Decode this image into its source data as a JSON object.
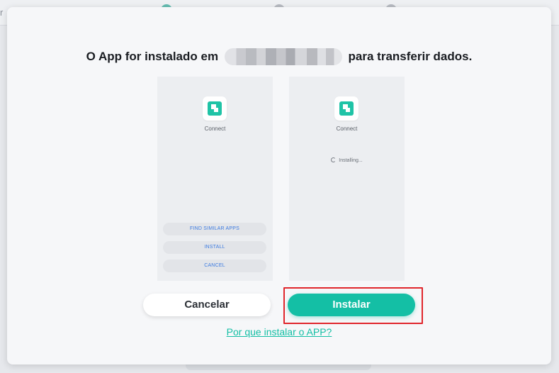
{
  "background": {
    "left_fragment": "r"
  },
  "dialog": {
    "title_prefix": "O App for instalado em",
    "title_suffix": "para transferir dados.",
    "preview_left": {
      "app_name": "Connect",
      "buttons": [
        "FIND SIMILAR APPS",
        "INSTALL",
        "CANCEL"
      ]
    },
    "preview_right": {
      "app_name": "Connect",
      "status": "Installing..."
    },
    "cancel_label": "Cancelar",
    "install_label": "Instalar",
    "why_link": "Por que instalar o APP?"
  },
  "colors": {
    "accent": "#14bfa5",
    "highlight": "#e0262c",
    "link": "#14bfa5"
  },
  "icons": {
    "app": "connect-app-icon",
    "loading": "spinner-icon"
  }
}
